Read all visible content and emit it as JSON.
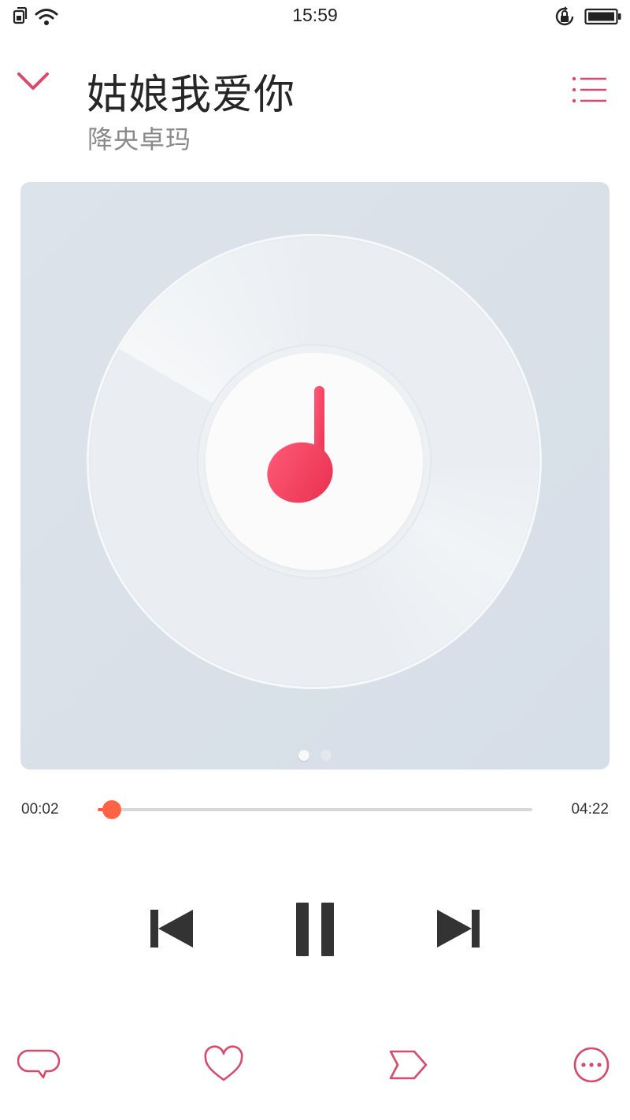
{
  "status_bar": {
    "time": "15:59",
    "icons": [
      "sim-card-icon",
      "wifi-icon",
      "rotation-lock-icon",
      "battery-icon"
    ]
  },
  "player": {
    "title": "姑娘我爱你",
    "artist": "降央卓玛",
    "current_time": "00:02",
    "total_time": "04:22",
    "progress_fraction": 0.008,
    "page_indicator": {
      "count": 2,
      "active_index": 0
    }
  },
  "icons": {
    "collapse": "chevron-down-icon",
    "playlist": "playlist-icon",
    "cover": "music-note-icon",
    "previous": "skip-previous-icon",
    "pause": "pause-icon",
    "next": "skip-next-icon",
    "comment": "comment-icon",
    "favorite": "heart-icon",
    "tag": "tag-icon",
    "more": "more-icon"
  },
  "colors": {
    "accent": "#d94a6a",
    "progress": "#ff5a4a",
    "control": "#333333",
    "note": "#ff4d6d"
  }
}
